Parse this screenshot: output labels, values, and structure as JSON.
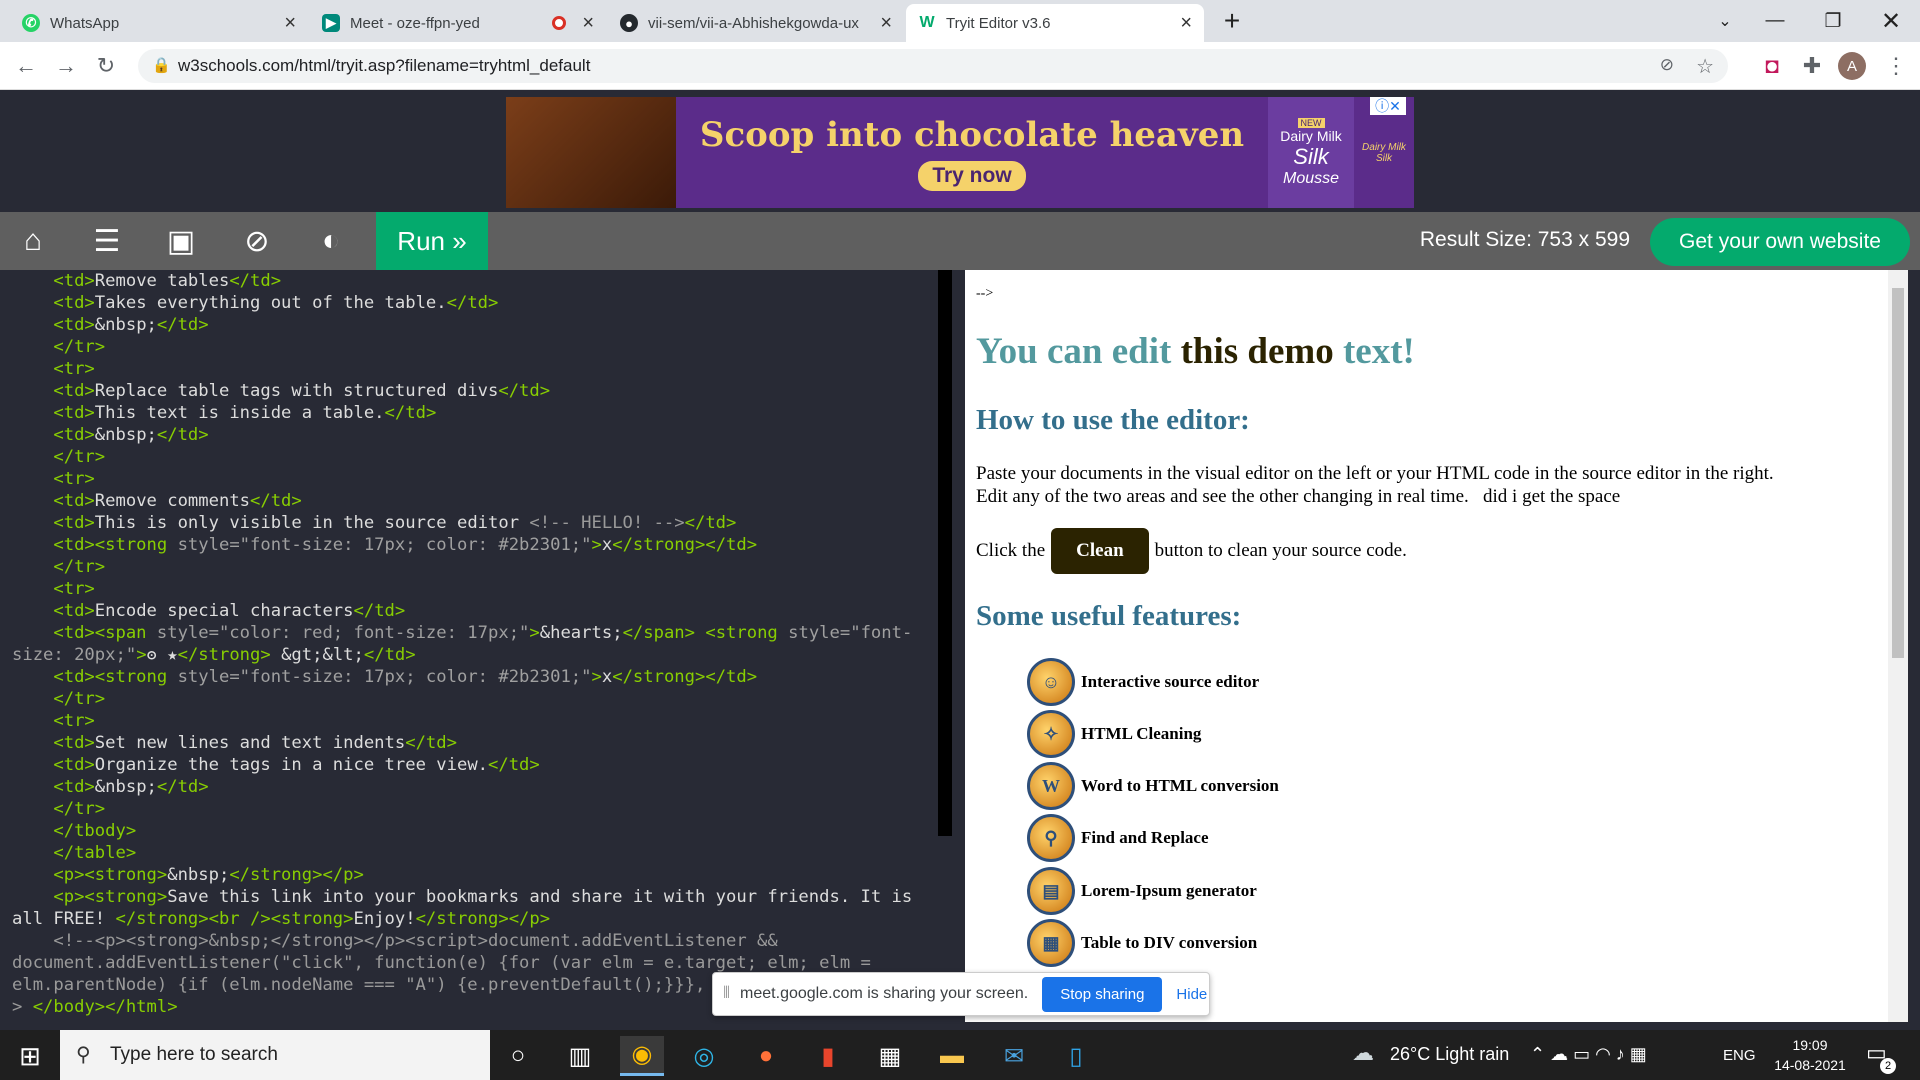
{
  "browser": {
    "tabs": [
      {
        "title": "WhatsApp",
        "icon": "whatsapp-icon",
        "color": "#25d366"
      },
      {
        "title": "Meet - oze-ffpn-yed",
        "icon": "meet-icon",
        "color": "#00897b"
      },
      {
        "title": "vii-sem/vii-a-Abhishekgowda-ux",
        "icon": "github-icon",
        "color": "#24292e"
      },
      {
        "title": "Tryit Editor v3.6",
        "icon": "w3schools-icon",
        "color": "#04aa6d"
      }
    ],
    "url": "w3schools.com/html/tryit.asp?filename=tryhtml_default",
    "profile_initial": "A"
  },
  "ad": {
    "headline": "Scoop into chocolate heaven",
    "cta": "Try now",
    "badge": "NEW",
    "brand_lines": [
      "Dairy Milk",
      "Silk",
      "Mousse"
    ],
    "mini_brand": "Dairy Milk Silk"
  },
  "toolbar": {
    "run_label": "Run »",
    "result_size": "Result Size: 753 x 599",
    "get_website": "Get your own website"
  },
  "code_lines": [
    [
      [
        "t",
        "    <td>"
      ],
      [
        "a",
        "Remove tables"
      ],
      [
        "t",
        "</td>"
      ]
    ],
    [
      [
        "t",
        "    <td>"
      ],
      [
        "a",
        "Takes everything out of the table."
      ],
      [
        "t",
        "</td>"
      ]
    ],
    [
      [
        "t",
        "    <td>"
      ],
      [
        "a",
        "&nbsp;"
      ],
      [
        "t",
        "</td>"
      ]
    ],
    [
      [
        "t",
        "    </tr>"
      ]
    ],
    [
      [
        "t",
        "    <tr>"
      ]
    ],
    [
      [
        "t",
        "    <td>"
      ],
      [
        "a",
        "Replace table tags with structured divs"
      ],
      [
        "t",
        "</td>"
      ]
    ],
    [
      [
        "t",
        "    <td>"
      ],
      [
        "a",
        "This text is inside a table."
      ],
      [
        "t",
        "</td>"
      ]
    ],
    [
      [
        "t",
        "    <td>"
      ],
      [
        "a",
        "&nbsp;"
      ],
      [
        "t",
        "</td>"
      ]
    ],
    [
      [
        "t",
        "    </tr>"
      ]
    ],
    [
      [
        "t",
        "    <tr>"
      ]
    ],
    [
      [
        "t",
        "    <td>"
      ],
      [
        "a",
        "Remove comments"
      ],
      [
        "t",
        "</td>"
      ]
    ],
    [
      [
        "t",
        "    <td>"
      ],
      [
        "a",
        "This is only visible in the source editor "
      ],
      [
        "c",
        "<!-- HELLO! -->"
      ],
      [
        "t",
        "</td>"
      ]
    ],
    [
      [
        "t",
        "    <td><strong "
      ],
      [
        "v",
        "style=\"font-size: 17px; color: #2b2301;\""
      ],
      [
        "t",
        ">"
      ],
      [
        "a",
        "x"
      ],
      [
        "t",
        "</strong></td>"
      ]
    ],
    [
      [
        "t",
        "    </tr>"
      ]
    ],
    [
      [
        "t",
        "    <tr>"
      ]
    ],
    [
      [
        "t",
        "    <td>"
      ],
      [
        "a",
        "Encode special characters"
      ],
      [
        "t",
        "</td>"
      ]
    ],
    [
      [
        "t",
        "    <td><span "
      ],
      [
        "v",
        "style=\"color: red; font-size: 17px;\""
      ],
      [
        "t",
        ">"
      ],
      [
        "a",
        "&hearts;"
      ],
      [
        "t",
        "</span> <strong "
      ],
      [
        "v",
        "style=\"font-"
      ]
    ],
    [
      [
        "v",
        "size: 20px;\""
      ],
      [
        "t",
        ">"
      ],
      [
        "a",
        "ʘ ★"
      ],
      [
        "t",
        "</strong>"
      ],
      [
        "a",
        " &gt;&lt;"
      ],
      [
        "t",
        "</td>"
      ]
    ],
    [
      [
        "t",
        "    <td><strong "
      ],
      [
        "v",
        "style=\"font-size: 17px; color: #2b2301;\""
      ],
      [
        "t",
        ">"
      ],
      [
        "a",
        "x"
      ],
      [
        "t",
        "</strong></td>"
      ]
    ],
    [
      [
        "t",
        "    </tr>"
      ]
    ],
    [
      [
        "t",
        "    <tr>"
      ]
    ],
    [
      [
        "t",
        "    <td>"
      ],
      [
        "a",
        "Set new lines and text indents"
      ],
      [
        "t",
        "</td>"
      ]
    ],
    [
      [
        "t",
        "    <td>"
      ],
      [
        "a",
        "Organize the tags in a nice tree view."
      ],
      [
        "t",
        "</td>"
      ]
    ],
    [
      [
        "t",
        "    <td>"
      ],
      [
        "a",
        "&nbsp;"
      ],
      [
        "t",
        "</td>"
      ]
    ],
    [
      [
        "t",
        "    </tr>"
      ]
    ],
    [
      [
        "t",
        "    </tbody>"
      ]
    ],
    [
      [
        "t",
        "    </table>"
      ]
    ],
    [
      [
        "t",
        "    <p><strong>"
      ],
      [
        "a",
        "&nbsp;"
      ],
      [
        "t",
        "</strong></p>"
      ]
    ],
    [
      [
        "t",
        "    <p><strong>"
      ],
      [
        "a",
        "Save this link into your bookmarks and share it with your friends. It is"
      ]
    ],
    [
      [
        "a",
        "all FREE! "
      ],
      [
        "t",
        "</strong><br /><strong>"
      ],
      [
        "a",
        "Enjoy!"
      ],
      [
        "t",
        "</strong></p>"
      ]
    ],
    [
      [
        "c",
        "    <!--<p><strong>&nbsp;</strong></p><script>document.addEventListener &&"
      ]
    ],
    [
      [
        "c",
        "document.addEventListener(\"click\", function(e) {for (var elm = e.target; elm; elm ="
      ]
    ],
    [
      [
        "c",
        "elm.parentNode) {if (elm.nodeName === \"A\") {e.preventDefault();}}},"
      ]
    ],
    [
      [
        "c",
        "> "
      ],
      [
        "t",
        "</body></html>"
      ]
    ]
  ],
  "result": {
    "comment_end": "-->",
    "h1_parts": [
      "You can edit",
      " this demo",
      " text!"
    ],
    "h2_how": "How to use the editor:",
    "para1": "Paste your documents in the visual editor on the left or your HTML code in the source editor in the right.",
    "para2": "Edit any of the two areas and see the other changing in real time.   did i get the space",
    "click_prefix": "Click the",
    "clean_label": "Clean",
    "click_suffix": "button to clean your source code.",
    "h2_features": "Some useful features:",
    "features": [
      {
        "label": "Interactive source editor",
        "icon": "source-editor-icon"
      },
      {
        "label": "HTML Cleaning",
        "icon": "html-cleaning-icon"
      },
      {
        "label": "Word to HTML conversion",
        "icon": "word-convert-icon"
      },
      {
        "label": "Find and Replace",
        "icon": "find-replace-icon"
      },
      {
        "label": "Lorem-Ipsum generator",
        "icon": "lorem-ipsum-icon"
      },
      {
        "label": "Table to DIV conversion",
        "icon": "table-div-icon"
      }
    ]
  },
  "meet_bar": {
    "message": "meet.google.com is sharing your screen.",
    "stop": "Stop sharing",
    "hide": "Hide"
  },
  "taskbar": {
    "search_placeholder": "Type here to search",
    "weather": "26°C  Light rain",
    "language": "ENG",
    "time": "19:09",
    "date": "14-08-2021",
    "notifications": "2"
  }
}
